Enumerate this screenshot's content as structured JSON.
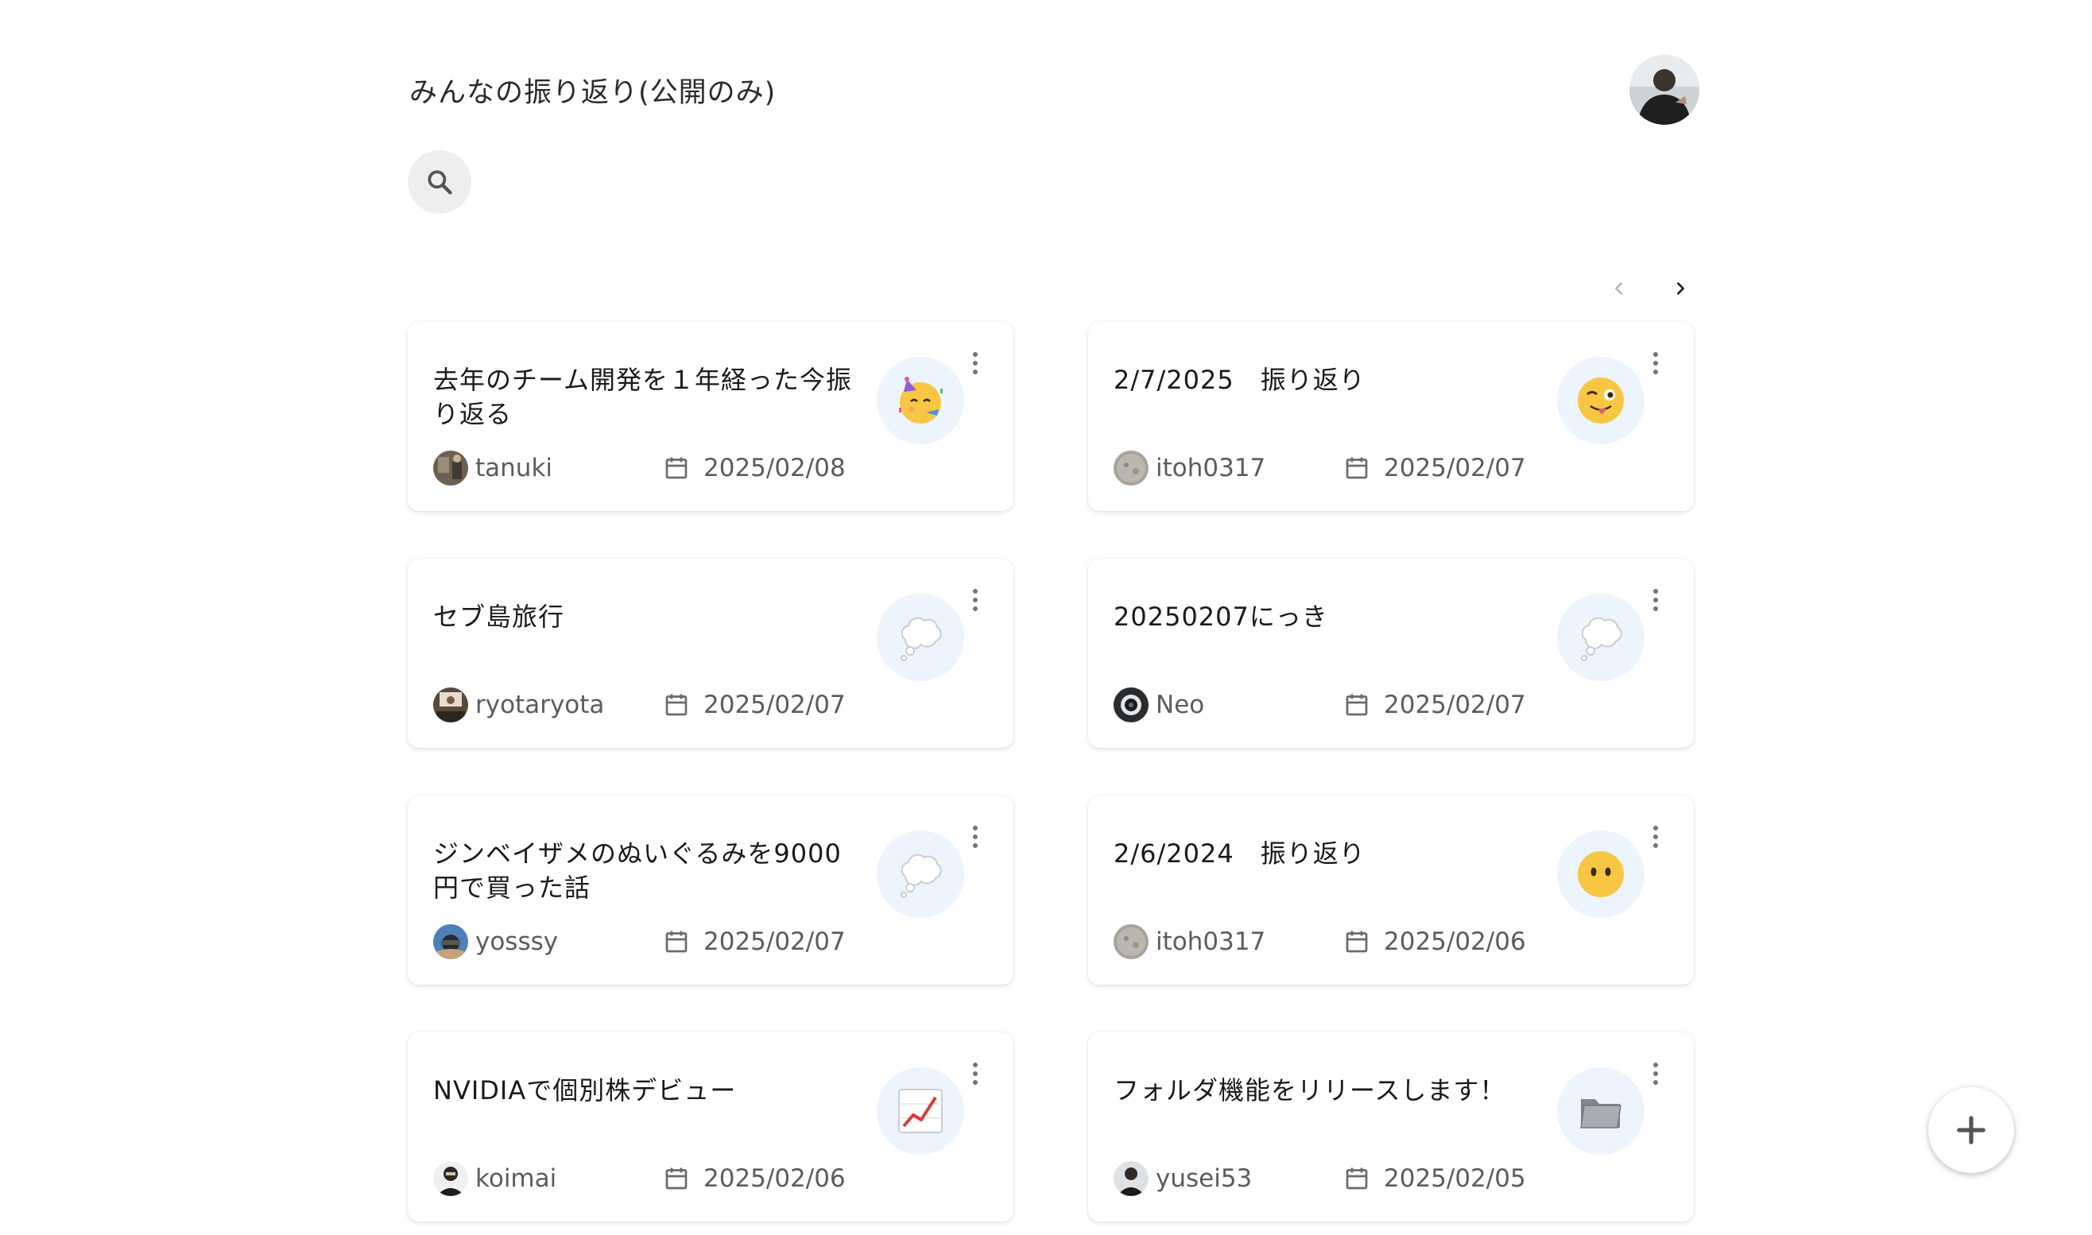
{
  "header": {
    "title": "みんなの振り返り(公開のみ)"
  },
  "search": {
    "icon": "search-icon"
  },
  "pagination": {
    "prev_icon": "chevron-left-icon",
    "next_icon": "chevron-right-icon"
  },
  "cards": [
    {
      "title": "去年のチーム開発を１年経った今振り返る",
      "emoji": "partying-face",
      "author": "tanuki",
      "date": "2025/02/08"
    },
    {
      "title": "2/7/2025　振り返り",
      "emoji": "winking-face-with-tongue",
      "author": "itoh0317",
      "date": "2025/02/07"
    },
    {
      "title": "セブ島旅行",
      "emoji": "thought-balloon",
      "author": "ryotaryota",
      "date": "2025/02/07"
    },
    {
      "title": "20250207にっき",
      "emoji": "thought-balloon",
      "author": "Neo",
      "date": "2025/02/07"
    },
    {
      "title": "ジンベイザメのぬいぐるみを9000円で買った話",
      "emoji": "thought-balloon",
      "author": "yosssy",
      "date": "2025/02/07"
    },
    {
      "title": "2/6/2024　振り返り",
      "emoji": "face-without-mouth",
      "author": "itoh0317",
      "date": "2025/02/06"
    },
    {
      "title": "NVIDIAで個別株デビュー",
      "emoji": "chart-increasing",
      "author": "koimai",
      "date": "2025/02/06"
    },
    {
      "title": "フォルダ機能をリリースします！",
      "emoji": "file-folder",
      "author": "yusei53",
      "date": "2025/02/05"
    }
  ],
  "fab": {
    "icon": "plus-icon"
  },
  "colors": {
    "emoji_bubble_bg": "#ecf4fd",
    "meta_text": "#5c5c5c",
    "search_bg": "#eeeeee"
  }
}
